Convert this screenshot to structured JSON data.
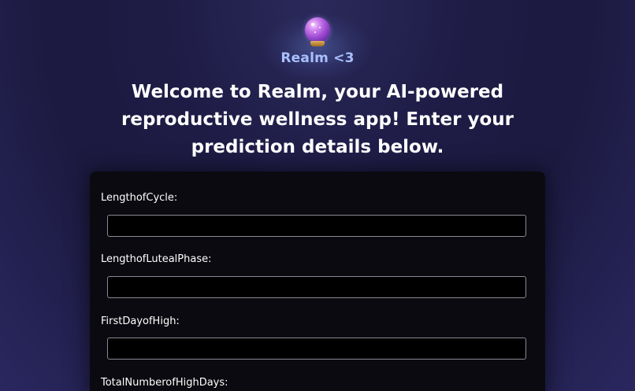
{
  "header": {
    "logo_icon": "crystal-ball-icon",
    "brand_name": "Realm <3",
    "headline": "Welcome to Realm, your AI-powered reproductive wellness app! Enter your prediction details below."
  },
  "form": {
    "fields": [
      {
        "label": "LengthofCycle:",
        "value": "",
        "placeholder": ""
      },
      {
        "label": "LengthofLutealPhase:",
        "value": "",
        "placeholder": ""
      },
      {
        "label": "FirstDayofHigh:",
        "value": "",
        "placeholder": ""
      },
      {
        "label": "TotalNumberofHighDays:",
        "value": "",
        "placeholder": ""
      }
    ]
  },
  "colors": {
    "brand_text": "#a9c0ff",
    "card_background": "#0a0a10",
    "input_border": "#8a8a92"
  }
}
